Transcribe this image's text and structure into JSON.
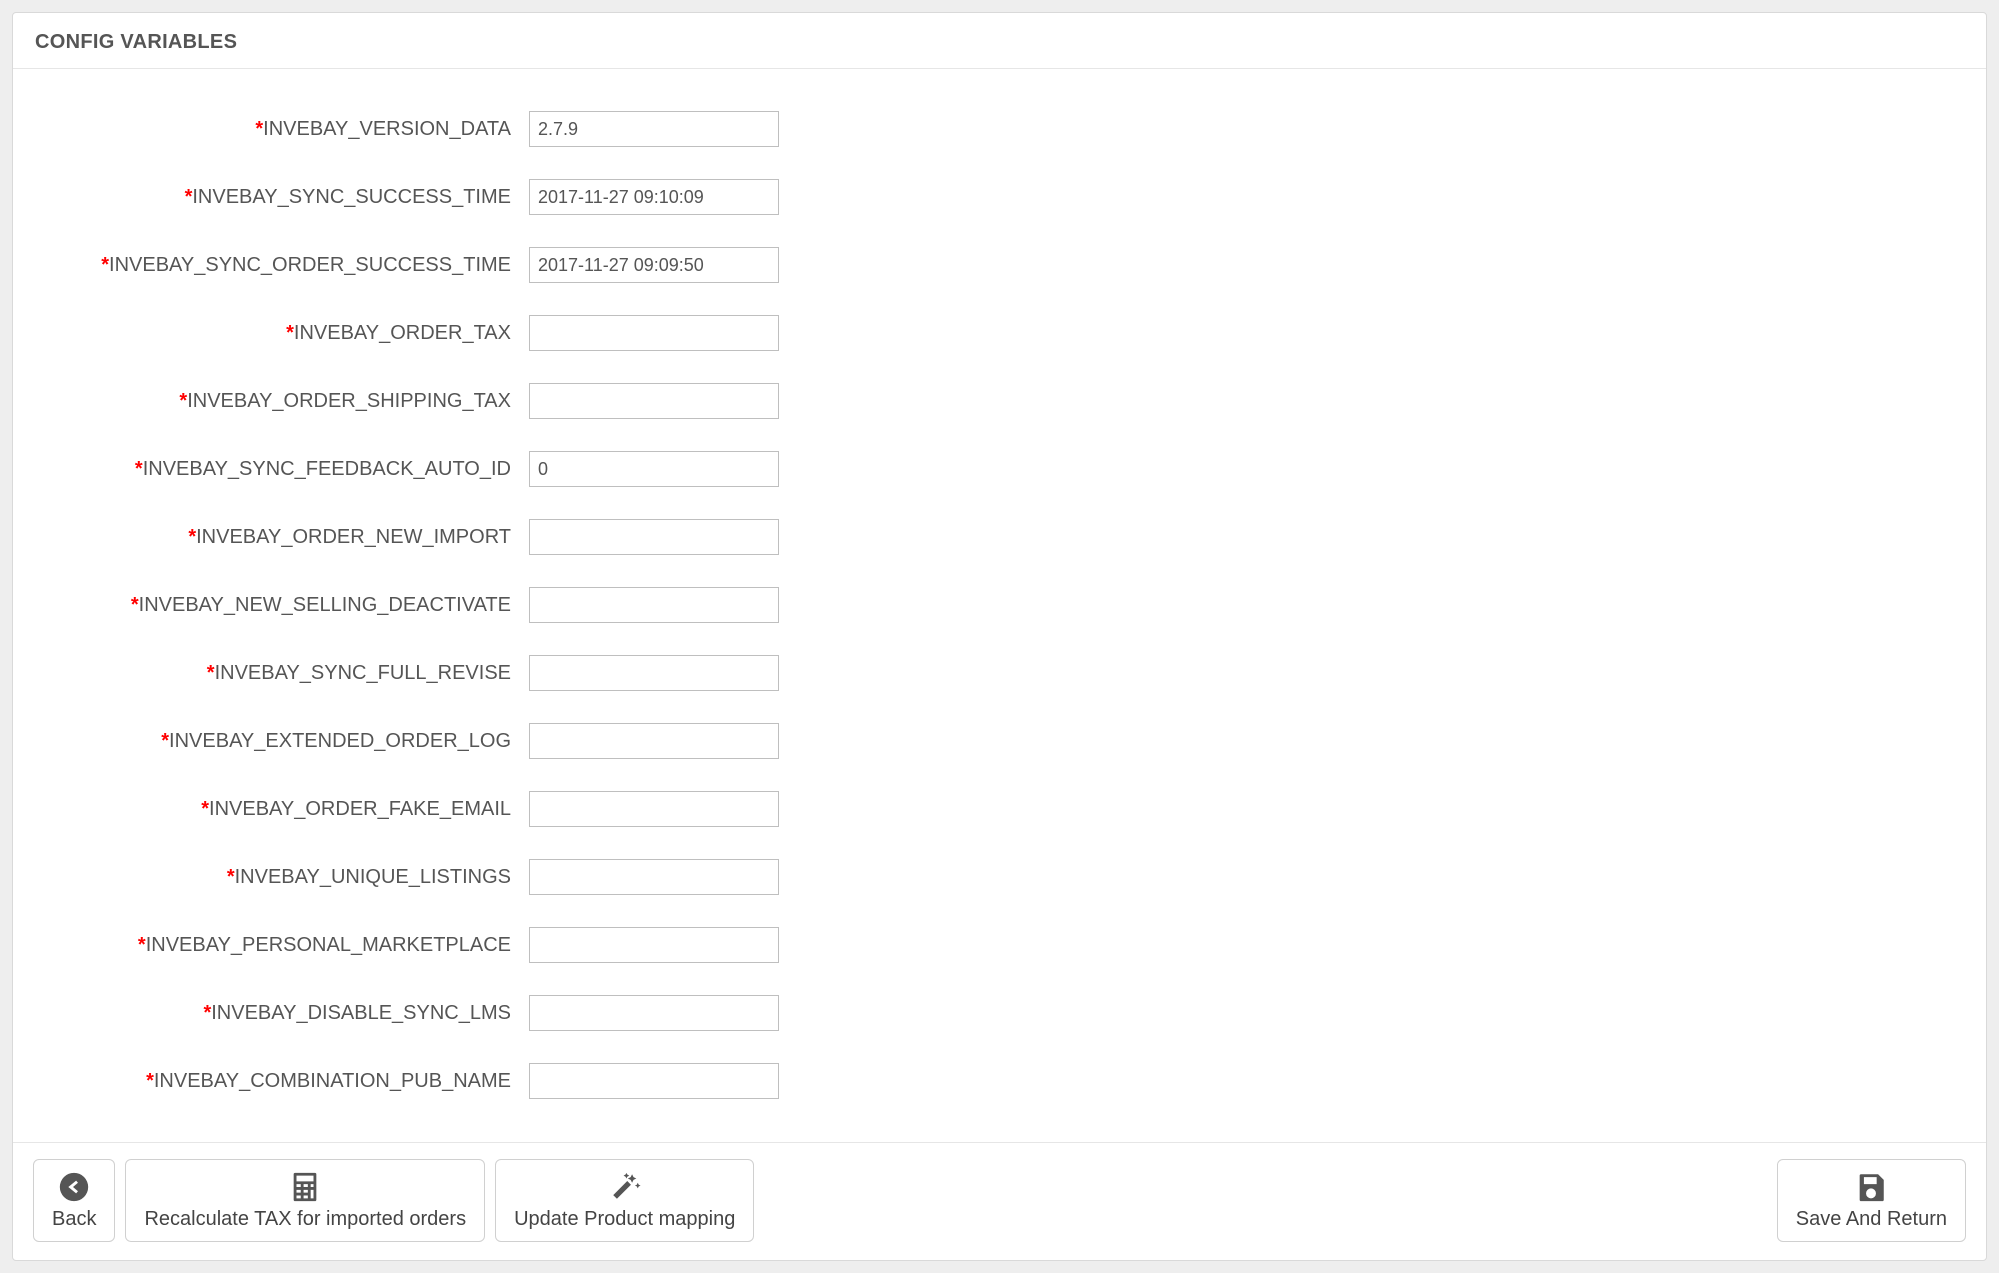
{
  "panel": {
    "title": "CONFIG VARIABLES"
  },
  "fields": [
    {
      "label": "INVEBAY_VERSION_DATA",
      "value": "2.7.9"
    },
    {
      "label": "INVEBAY_SYNC_SUCCESS_TIME",
      "value": "2017-11-27 09:10:09"
    },
    {
      "label": "INVEBAY_SYNC_ORDER_SUCCESS_TIME",
      "value": "2017-11-27 09:09:50"
    },
    {
      "label": "INVEBAY_ORDER_TAX",
      "value": ""
    },
    {
      "label": "INVEBAY_ORDER_SHIPPING_TAX",
      "value": ""
    },
    {
      "label": "INVEBAY_SYNC_FEEDBACK_AUTO_ID",
      "value": "0"
    },
    {
      "label": "INVEBAY_ORDER_NEW_IMPORT",
      "value": ""
    },
    {
      "label": "INVEBAY_NEW_SELLING_DEACTIVATE",
      "value": ""
    },
    {
      "label": "INVEBAY_SYNC_FULL_REVISE",
      "value": ""
    },
    {
      "label": "INVEBAY_EXTENDED_ORDER_LOG",
      "value": ""
    },
    {
      "label": "INVEBAY_ORDER_FAKE_EMAIL",
      "value": ""
    },
    {
      "label": "INVEBAY_UNIQUE_LISTINGS",
      "value": ""
    },
    {
      "label": "INVEBAY_PERSONAL_MARKETPLACE",
      "value": ""
    },
    {
      "label": "INVEBAY_DISABLE_SYNC_LMS",
      "value": ""
    },
    {
      "label": "INVEBAY_COMBINATION_PUB_NAME",
      "value": ""
    }
  ],
  "footer": {
    "back": "Back",
    "recalc": "Recalculate TAX for imported orders",
    "update_mapping": "Update Product mapping",
    "save": "Save And Return"
  }
}
